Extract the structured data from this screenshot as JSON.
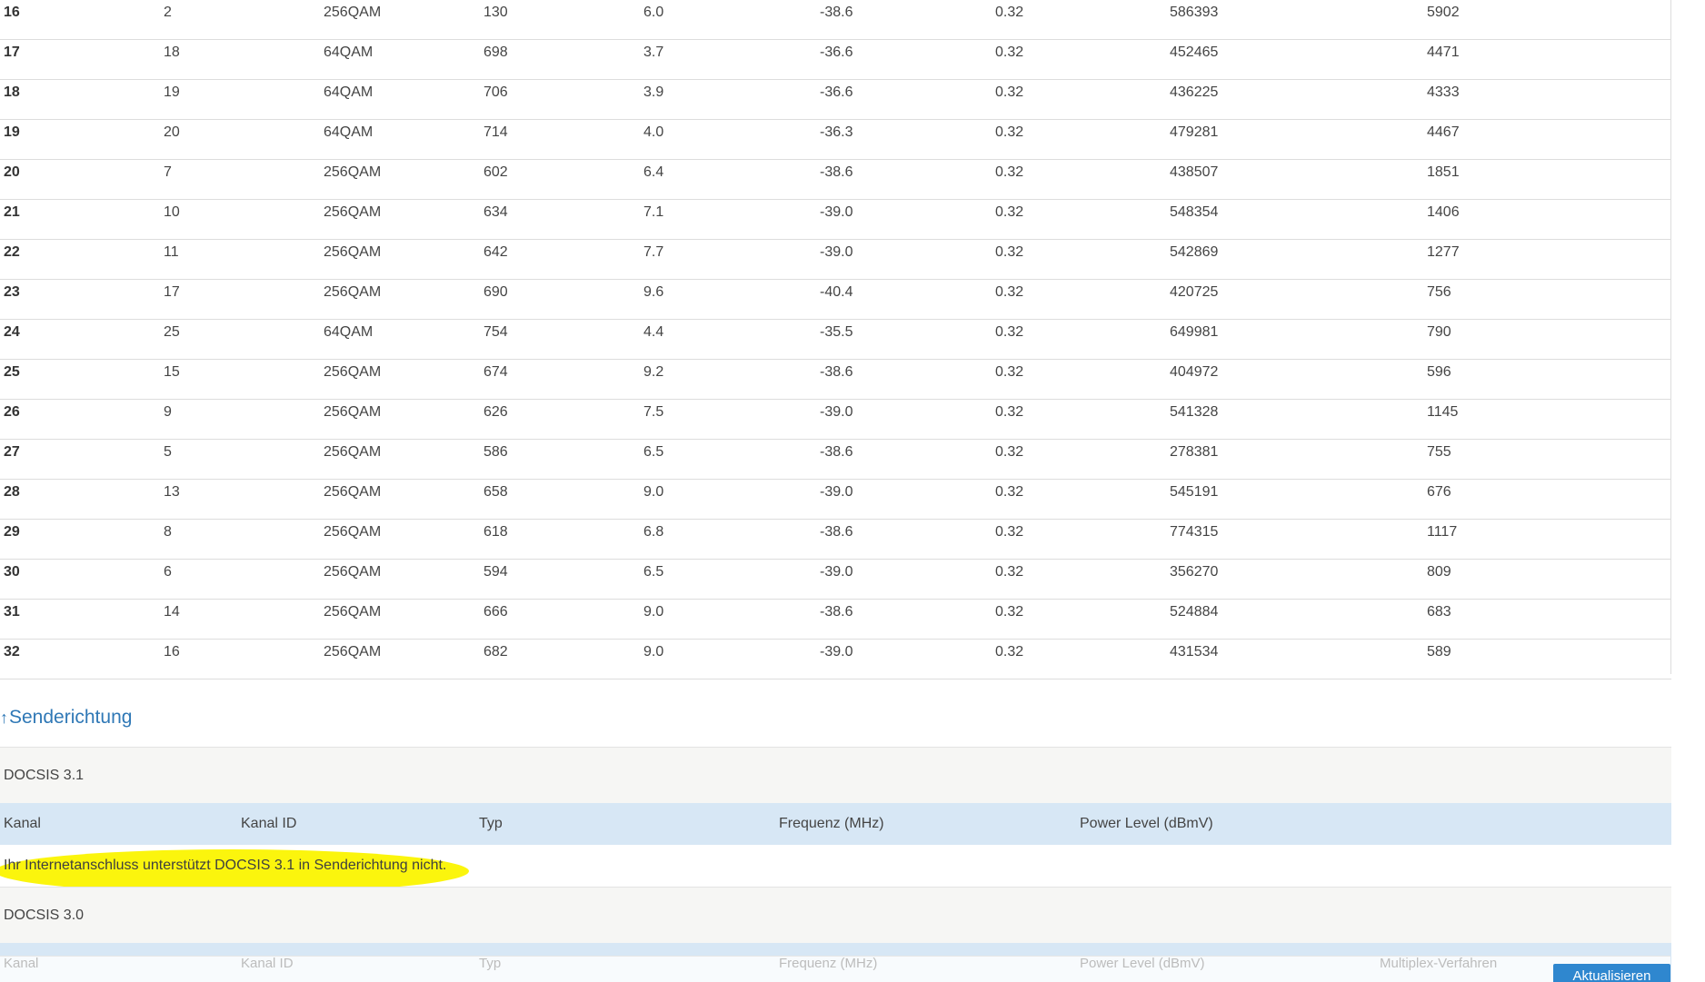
{
  "downstream": {
    "rows": [
      [
        "16",
        "2",
        "256QAM",
        "130",
        "6.0",
        "-38.6",
        "0.32",
        "586393",
        "5902"
      ],
      [
        "17",
        "18",
        "64QAM",
        "698",
        "3.7",
        "-36.6",
        "0.32",
        "452465",
        "4471"
      ],
      [
        "18",
        "19",
        "64QAM",
        "706",
        "3.9",
        "-36.6",
        "0.32",
        "436225",
        "4333"
      ],
      [
        "19",
        "20",
        "64QAM",
        "714",
        "4.0",
        "-36.3",
        "0.32",
        "479281",
        "4467"
      ],
      [
        "20",
        "7",
        "256QAM",
        "602",
        "6.4",
        "-38.6",
        "0.32",
        "438507",
        "1851"
      ],
      [
        "21",
        "10",
        "256QAM",
        "634",
        "7.1",
        "-39.0",
        "0.32",
        "548354",
        "1406"
      ],
      [
        "22",
        "11",
        "256QAM",
        "642",
        "7.7",
        "-39.0",
        "0.32",
        "542869",
        "1277"
      ],
      [
        "23",
        "17",
        "256QAM",
        "690",
        "9.6",
        "-40.4",
        "0.32",
        "420725",
        "756"
      ],
      [
        "24",
        "25",
        "64QAM",
        "754",
        "4.4",
        "-35.5",
        "0.32",
        "649981",
        "790"
      ],
      [
        "25",
        "15",
        "256QAM",
        "674",
        "9.2",
        "-38.6",
        "0.32",
        "404972",
        "596"
      ],
      [
        "26",
        "9",
        "256QAM",
        "626",
        "7.5",
        "-39.0",
        "0.32",
        "541328",
        "1145"
      ],
      [
        "27",
        "5",
        "256QAM",
        "586",
        "6.5",
        "-38.6",
        "0.32",
        "278381",
        "755"
      ],
      [
        "28",
        "13",
        "256QAM",
        "658",
        "9.0",
        "-39.0",
        "0.32",
        "545191",
        "676"
      ],
      [
        "29",
        "8",
        "256QAM",
        "618",
        "6.8",
        "-38.6",
        "0.32",
        "774315",
        "1117"
      ],
      [
        "30",
        "6",
        "256QAM",
        "594",
        "6.5",
        "-39.0",
        "0.32",
        "356270",
        "809"
      ],
      [
        "31",
        "14",
        "256QAM",
        "666",
        "9.0",
        "-38.6",
        "0.32",
        "524884",
        "683"
      ],
      [
        "32",
        "16",
        "256QAM",
        "682",
        "9.0",
        "-39.0",
        "0.32",
        "431534",
        "589"
      ]
    ]
  },
  "upstream": {
    "heading": "Senderichtung",
    "arrow_icon": "↑",
    "docsis31": {
      "label": "DOCSIS 3.1",
      "columns": [
        "Kanal",
        "Kanal ID",
        "Typ",
        "Frequenz (MHz)",
        "Power Level (dBmV)"
      ],
      "message": "Ihr Internetanschluss unterstützt DOCSIS 3.1 in Senderichtung nicht."
    },
    "docsis30": {
      "label": "DOCSIS 3.0",
      "columns": [
        "Kanal",
        "Kanal ID",
        "Typ",
        "Frequenz (MHz)",
        "Power Level (dBmV)",
        "Multiplex-Verfahren"
      ]
    }
  },
  "footer": {
    "refresh_label": "Aktualisieren"
  },
  "colors": {
    "heading": "#2f78b6",
    "header_band": "#d7e7f5",
    "section_band": "#f6f6f4",
    "highlight": "#fbf50d",
    "button": "#2f87cf"
  }
}
